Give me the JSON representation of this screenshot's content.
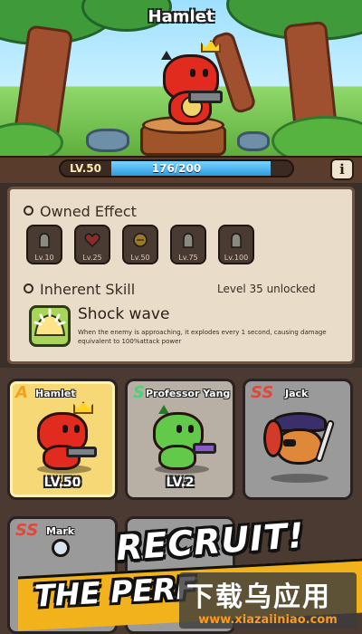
{
  "hero": {
    "name": "Hamlet"
  },
  "level": {
    "label": "LV.50",
    "exp_text": "176/200",
    "exp_fraction": 0.88
  },
  "owned_effect": {
    "title": "Owned Effect",
    "slots": [
      {
        "label": "Lv.10",
        "icon": "tombstone-icon"
      },
      {
        "label": "Lv.25",
        "icon": "heart-icon"
      },
      {
        "label": "Lv.50",
        "icon": "coin-icon"
      },
      {
        "label": "Lv.75",
        "icon": "tombstone-icon"
      },
      {
        "label": "Lv.100",
        "icon": "tombstone-icon"
      }
    ]
  },
  "inherent_skill": {
    "title": "Inherent Skill",
    "unlock_text": "Level 35 unlocked",
    "name": "Shock wave",
    "description": "When the enemy is approaching, it explodes every 1 second, causing damage equivalent to 100%attack power"
  },
  "cards": [
    {
      "rank": "A",
      "name": "Hamlet",
      "level": "LV.50",
      "selected": true,
      "rank_color": "#f2a21a"
    },
    {
      "rank": "S",
      "name": "Professor Yang",
      "level": "LV.2",
      "selected": false,
      "rank_color": "#4fd07a"
    },
    {
      "rank": "SS",
      "name": "Jack",
      "level": "",
      "selected": false,
      "rank_color": "#e0483a"
    },
    {
      "rank": "SS",
      "name": "Mark",
      "level": "",
      "selected": false,
      "rank_color": "#e0483a"
    }
  ],
  "promo": {
    "line1": "RECRUIT!",
    "line2": "THE PERF"
  },
  "watermark": {
    "chinese": "下载乌应用",
    "url": "www.xiazaiiniao.com"
  },
  "colors": {
    "exp_bar": "#2e9bde",
    "panel": "#e9ddc9",
    "selected_card": "#f6d876"
  }
}
